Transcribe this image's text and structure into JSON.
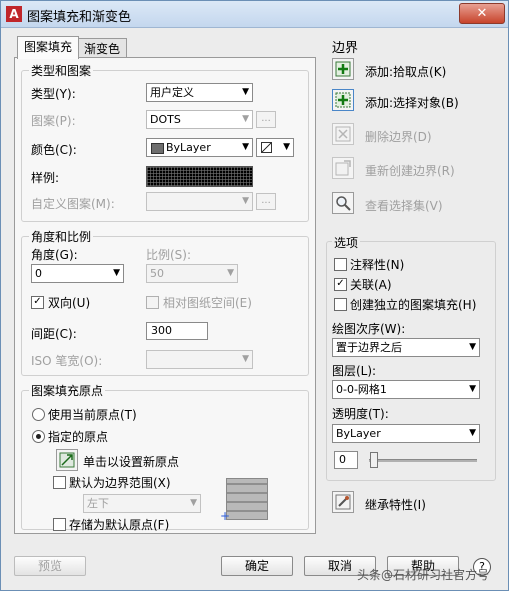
{
  "window": {
    "title": "图案填充和渐变色",
    "app_icon": "A",
    "close": "✕"
  },
  "tabs": [
    {
      "label": "图案填充"
    },
    {
      "label": "渐变色"
    }
  ],
  "type_pattern": {
    "title": "类型和图案",
    "type_label": "类型(Y):",
    "type_value": "用户定义",
    "pattern_label": "图案(P):",
    "pattern_value": "DOTS",
    "color_label": "颜色(C):",
    "color_value": "ByLayer",
    "sample_label": "样例:",
    "custom_label": "自定义图案(M):",
    "ellipsis": "..."
  },
  "angle_scale": {
    "title": "角度和比例",
    "angle_label": "角度(G):",
    "angle_value": "0",
    "scale_label": "比例(S):",
    "scale_value": "50",
    "double_label": "双向(U)",
    "double_checked": true,
    "relative_label": "相对图纸空间(E)",
    "spacing_label": "间距(C):",
    "spacing_value": "300",
    "iso_label": "ISO 笔宽(O):"
  },
  "origin": {
    "title": "图案填充原点",
    "current_label": "使用当前原点(T)",
    "specified_label": "指定的原点",
    "click_set_label": "单击以设置新原点",
    "default_extents_label": "默认为边界范围(X)",
    "extents_value": "左下",
    "store_default_label": "存储为默认原点(F)"
  },
  "boundaries": {
    "title": "边界",
    "add_pick_label": "添加:拾取点(K)",
    "add_select_label": "添加:选择对象(B)",
    "remove_label": "删除边界(D)",
    "recreate_label": "重新创建边界(R)",
    "view_label": "查看选择集(V)"
  },
  "options": {
    "title": "选项",
    "annotative_label": "注释性(N)",
    "associative_label": "关联(A)",
    "associative_checked": true,
    "separate_label": "创建独立的图案填充(H)",
    "draw_order_label": "绘图次序(W):",
    "draw_order_value": "置于边界之后",
    "layer_label": "图层(L):",
    "layer_value": "0-0-网格1",
    "transparency_label": "透明度(T):",
    "transparency_value": "ByLayer",
    "transparency_amount": "0"
  },
  "inherit_label": "继承特性(I)",
  "footer": {
    "preview": "预览",
    "ok": "确定",
    "cancel": "取消",
    "help": "帮助",
    "help_icon": "?"
  },
  "watermark": "头条@石材研习社官方号"
}
